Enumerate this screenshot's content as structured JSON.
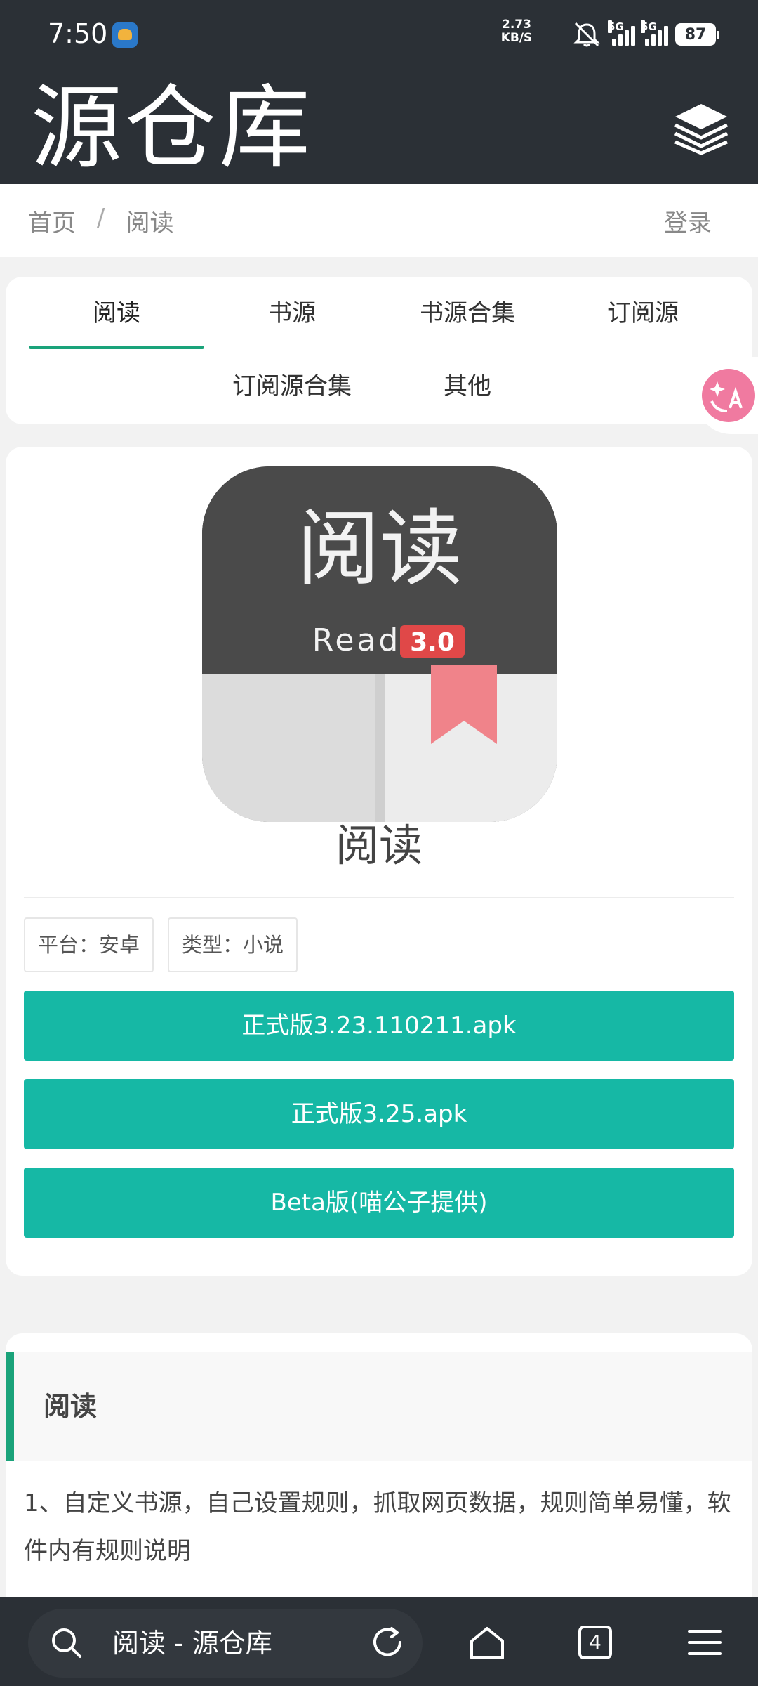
{
  "status_bar": {
    "time": "7:50",
    "net_speed_value": "2.73",
    "net_speed_unit": "KB/S",
    "network_1": "5G",
    "network_2": "5G",
    "battery": "87"
  },
  "header": {
    "title": "源仓库",
    "menu_icon": "layers-icon"
  },
  "breadcrumb": {
    "home": "首页",
    "separator": "/",
    "current": "阅读",
    "login": "登录"
  },
  "tabs": [
    {
      "label": "阅读",
      "active": true
    },
    {
      "label": "书源"
    },
    {
      "label": "书源合集"
    },
    {
      "label": "订阅源"
    },
    {
      "label": "订阅源合集"
    },
    {
      "label": "其他"
    }
  ],
  "app": {
    "icon_text_main": "阅读",
    "icon_text_read": "Read",
    "icon_text_version": "3.0",
    "name": "阅读",
    "tags": [
      "平台：安卓",
      "类型：小说"
    ],
    "downloads": [
      "正式版3.23.110211.apk",
      "正式版3.25.apk",
      "Beta版(喵公子提供)"
    ]
  },
  "description": {
    "title": "阅读",
    "text": "1、自定义书源，自己设置规则，抓取网页数据，规则简单易懂，软件内有规则说明"
  },
  "bottom_bar": {
    "url_text": "阅读 - 源仓库",
    "tab_count": "4"
  },
  "colors": {
    "dark_bar": "#2b3036",
    "accent_green": "#1aa37a",
    "button_teal": "#16b8a5"
  }
}
